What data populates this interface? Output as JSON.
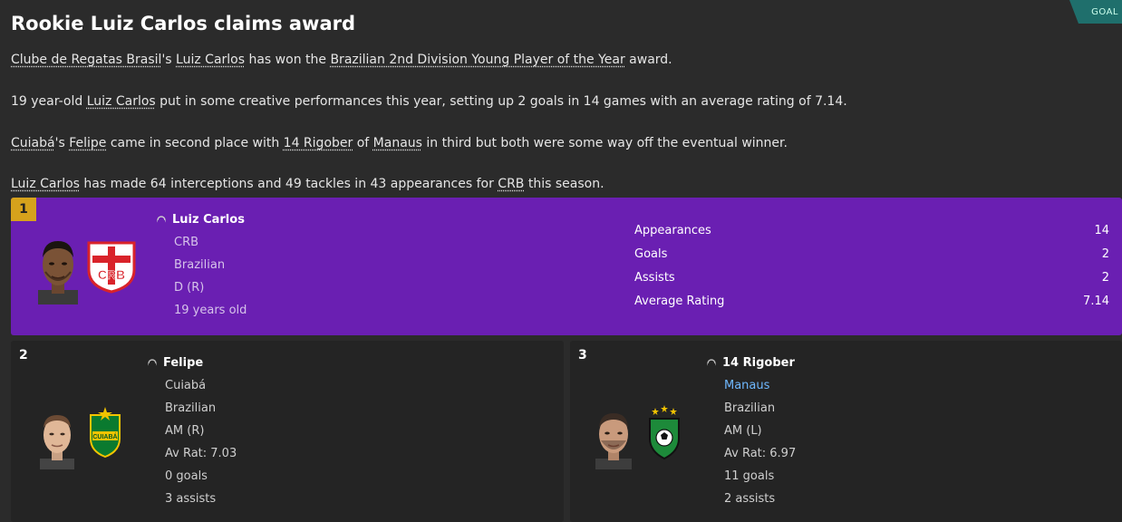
{
  "header": {
    "title": "Rookie Luiz Carlos claims award",
    "tag": "GOAL"
  },
  "paragraphs": {
    "p1": {
      "club": "Clube de Regatas Brasil",
      "s1": "'s ",
      "player": "Luiz Carlos",
      "s2": " has won the ",
      "award": "Brazilian 2nd Division Young Player of the Year",
      "s3": " award."
    },
    "p2": {
      "s1": "19 year-old ",
      "player": "Luiz Carlos",
      "s2": " put in some creative performances this year, setting up 2 goals in 14 games with an average rating of 7.14."
    },
    "p3": {
      "club": "Cuiabá",
      "s1": "'s ",
      "player2": "Felipe",
      "s2": " came in second place with ",
      "player3": "14 Rigober",
      "s3": " of ",
      "club3": "Manaus",
      "s4": " in third but both were some way off the eventual winner."
    },
    "p4": {
      "player": "Luiz Carlos",
      "s1": " has made 64 interceptions and 49 tackles in 43 appearances for ",
      "club": "CRB",
      "s2": " this season."
    }
  },
  "first": {
    "rank": "1",
    "name": "Luiz Carlos",
    "club": "CRB",
    "nationality": "Brazilian",
    "position": "D (R)",
    "age": "19 years old",
    "stats": [
      {
        "label": "Appearances",
        "value": "14"
      },
      {
        "label": "Goals",
        "value": "2"
      },
      {
        "label": "Assists",
        "value": "2"
      },
      {
        "label": "Average Rating",
        "value": "7.14"
      }
    ]
  },
  "second": {
    "rank": "2",
    "name": "Felipe",
    "club": "Cuiabá",
    "nationality": "Brazilian",
    "position": "AM (R)",
    "rating": "Av Rat: 7.03",
    "goals": "0 goals",
    "assists": "3 assists"
  },
  "third": {
    "rank": "3",
    "name": "14 Rigober",
    "club": "Manaus",
    "nationality": "Brazilian",
    "position": "AM (L)",
    "rating": "Av Rat: 6.97",
    "goals": "11 goals",
    "assists": "2 assists"
  },
  "badges": {
    "crb": "CRB",
    "cuiaba": "CUIABÁ"
  },
  "colors": {
    "winner_bg": "#6a1fb2",
    "gold": "#d6a21c",
    "teal": "#1f6f6c",
    "link_blue": "#6fb8ff"
  }
}
